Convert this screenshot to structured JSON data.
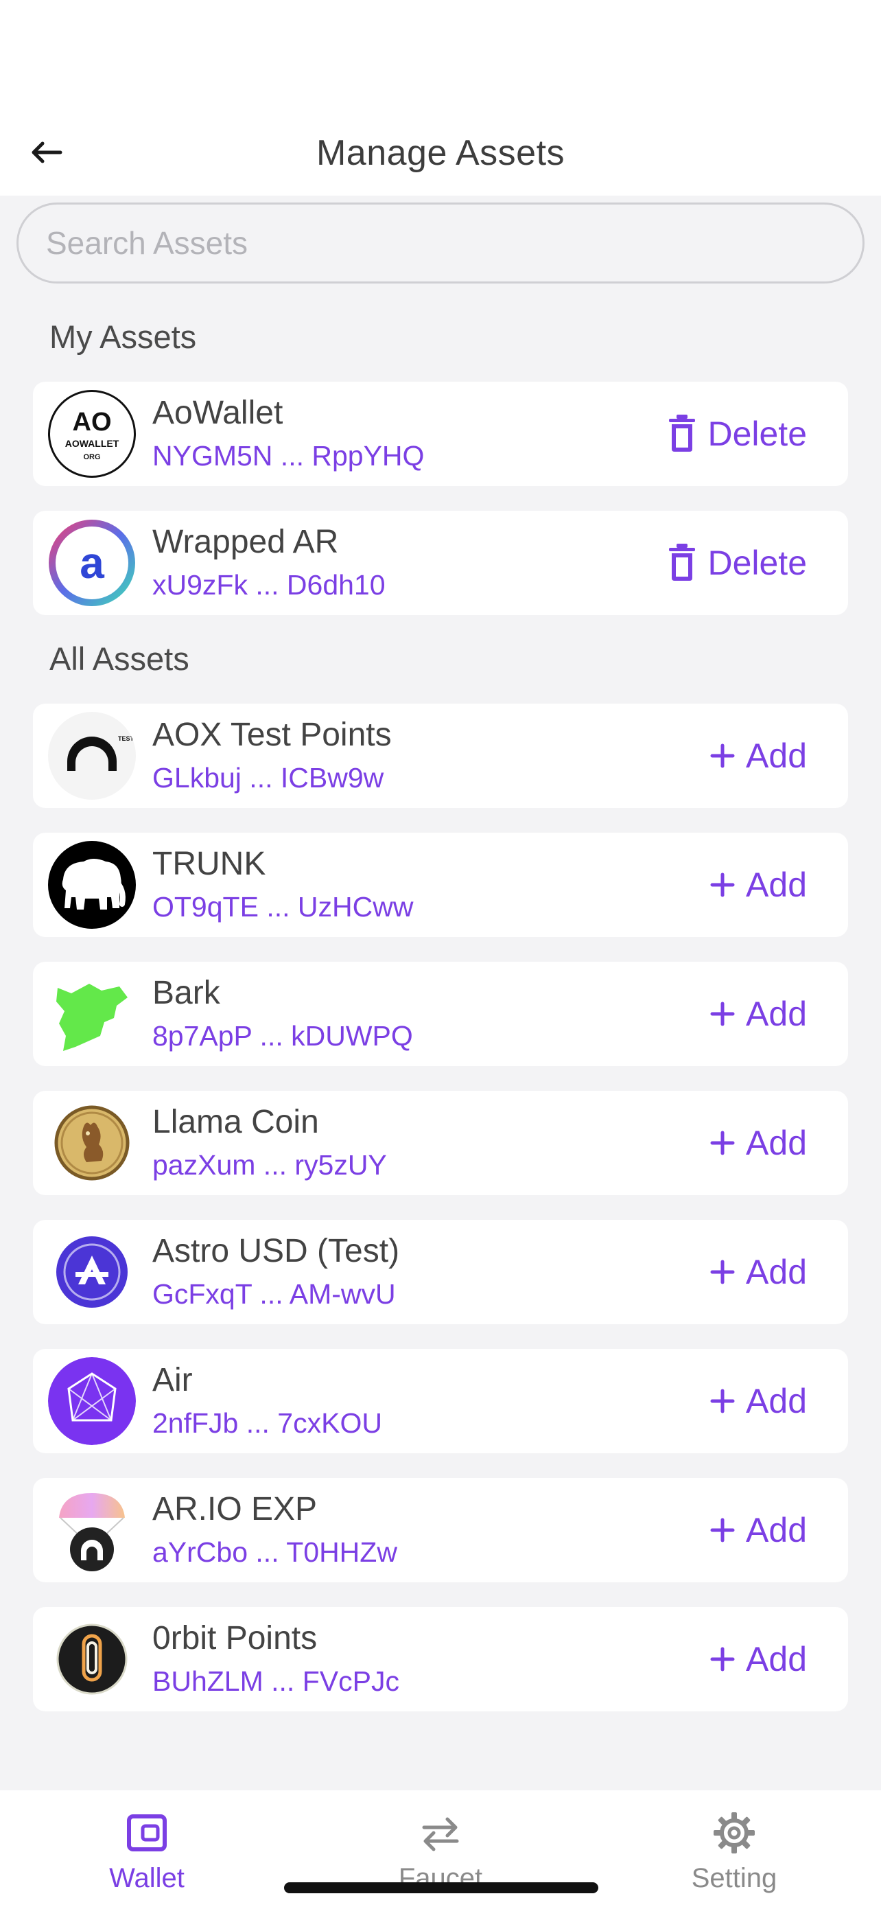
{
  "header": {
    "title": "Manage Assets"
  },
  "search": {
    "placeholder": "Search Assets",
    "value": ""
  },
  "sections": {
    "my_assets": "My Assets",
    "all_assets": "All Assets"
  },
  "my_assets": [
    {
      "name": "AoWallet",
      "address": "NYGM5N ... RppYHQ",
      "action": "Delete",
      "logo": "aowallet-logo"
    },
    {
      "name": "Wrapped AR",
      "address": "xU9zFk ... D6dh10",
      "action": "Delete",
      "logo": "wrapped-ar-logo"
    }
  ],
  "all_assets": [
    {
      "name": "AOX Test Points",
      "address": "GLkbuj ... ICBw9w",
      "action": "Add",
      "logo": "aox-logo"
    },
    {
      "name": "TRUNK",
      "address": "OT9qTE ... UzHCww",
      "action": "Add",
      "logo": "trunk-elephant-logo"
    },
    {
      "name": "Bark",
      "address": "8p7ApP ... kDUWPQ",
      "action": "Add",
      "logo": "bark-logo"
    },
    {
      "name": "Llama Coin",
      "address": "pazXum ... ry5zUY",
      "action": "Add",
      "logo": "llama-coin-logo"
    },
    {
      "name": "Astro USD (Test)",
      "address": "GcFxqT ... AM-wvU",
      "action": "Add",
      "logo": "astro-logo"
    },
    {
      "name": "Air",
      "address": "2nfFJb ... 7cxKOU",
      "action": "Add",
      "logo": "air-logo"
    },
    {
      "name": "AR.IO EXP",
      "address": "aYrCbo ... T0HHZw",
      "action": "Add",
      "logo": "ario-logo"
    },
    {
      "name": "0rbit Points",
      "address": "BUhZLM ... FVcPJc",
      "action": "Add",
      "logo": "orbit-logo"
    }
  ],
  "tabs": [
    {
      "label": "Wallet",
      "icon": "wallet-icon",
      "active": true
    },
    {
      "label": "Faucet",
      "icon": "swap-arrows-icon",
      "active": false
    },
    {
      "label": "Setting",
      "icon": "gear-icon",
      "active": false
    }
  ],
  "lettering": {
    "aowallet_logo_top": "AO",
    "aowallet_logo_mid": "AOWALLET",
    "aowallet_logo_bottom": "ORG",
    "wrapped_ar_logo": "a",
    "aox_logo": "TEST"
  },
  "colors": {
    "accent": "#7b3fe4",
    "background": "#f3f3f5",
    "card": "#ffffff"
  }
}
